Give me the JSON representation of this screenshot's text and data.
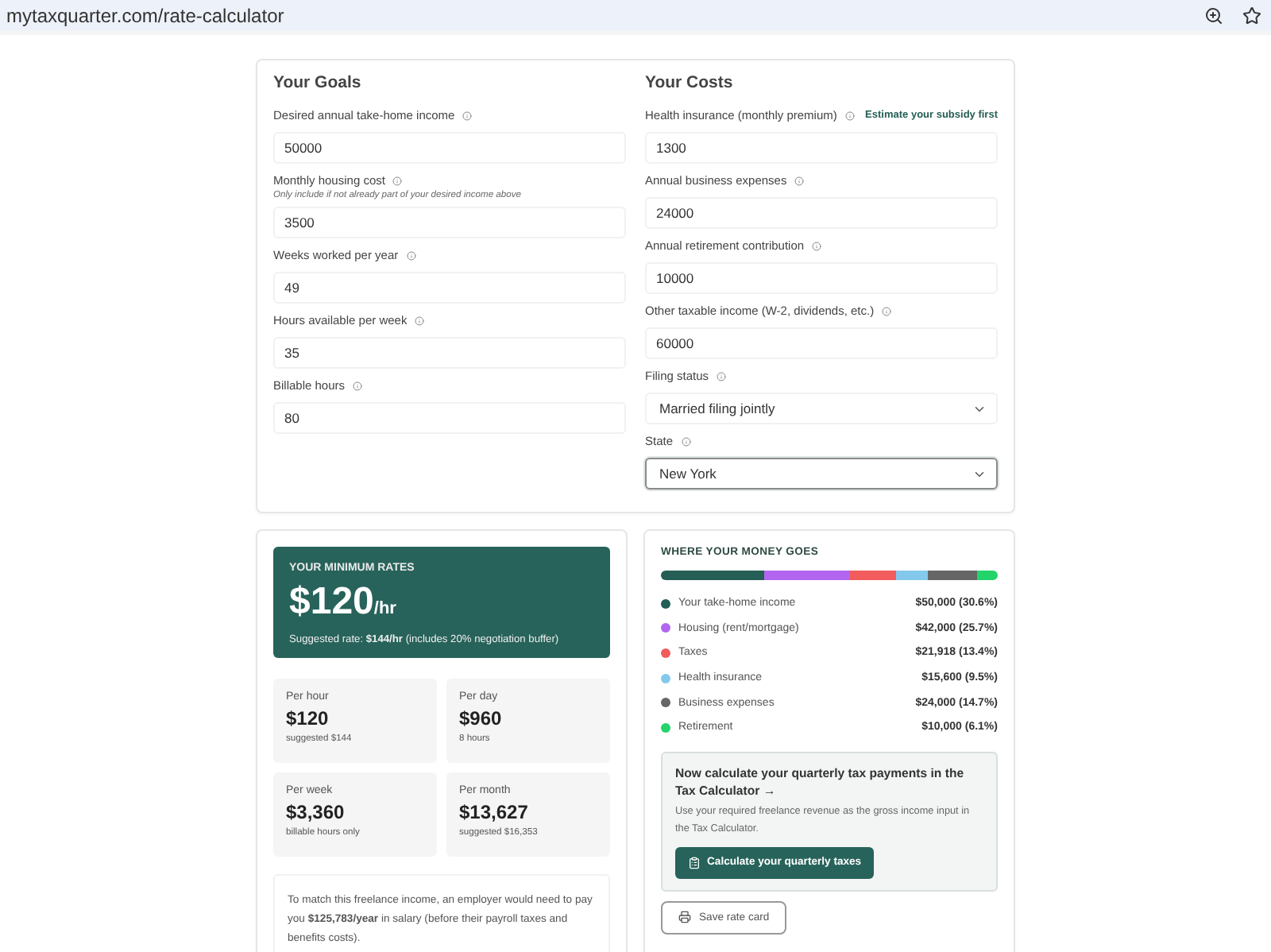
{
  "browser": {
    "url": "mytaxquarter.com/rate-calculator"
  },
  "goals": {
    "title": "Your Goals",
    "fields": [
      {
        "kind": "text",
        "label": "Desired annual take-home income",
        "value": "50000"
      },
      {
        "kind": "text",
        "label": "Monthly housing cost",
        "hint": "Only include if not already part of your desired income above",
        "value": "3500"
      },
      {
        "kind": "text",
        "label": "Weeks worked per year",
        "value": "49"
      },
      {
        "kind": "text",
        "label": "Hours available per week",
        "value": "35"
      },
      {
        "kind": "text",
        "label": "Billable hours",
        "value": "80"
      }
    ]
  },
  "costs": {
    "title": "Your Costs",
    "fields": [
      {
        "kind": "text",
        "label": "Health insurance (monthly premium)",
        "link": "Estimate your subsidy first",
        "value": "1300"
      },
      {
        "kind": "text",
        "label": "Annual business expenses",
        "value": "24000"
      },
      {
        "kind": "text",
        "label": "Annual retirement contribution",
        "value": "10000"
      },
      {
        "kind": "text",
        "label": "Other taxable income (W-2, dividends, etc.)",
        "value": "60000"
      },
      {
        "kind": "select",
        "label": "Filing status",
        "value": "Married filing jointly",
        "focused": false
      },
      {
        "kind": "select",
        "label": "State",
        "value": "New York",
        "focused": true
      }
    ]
  },
  "rates": {
    "title": "YOUR MINIMUM RATES",
    "amount": "$120",
    "unit": "/hr",
    "suggestion": "Suggested rate: **$144/hr** (includes 20% negotiation buffer)",
    "stats": [
      {
        "label": "Per hour",
        "value": "$120",
        "note": "suggested $144"
      },
      {
        "label": "Per day",
        "value": "$960",
        "note": "8 hours"
      },
      {
        "label": "Per week",
        "value": "$3,360",
        "note": "billable hours only"
      },
      {
        "label": "Per month",
        "value": "$13,627",
        "note": "suggested $16,353"
      }
    ],
    "employer_note": "To match this freelance income, an employer would need to pay you **$125,783/year** in salary (before their payroll taxes and benefits costs)."
  },
  "breakdown": {
    "title": "WHERE YOUR MONEY GOES",
    "items": [
      {
        "label": "Your take-home income",
        "amount": "$50,000 (30.6%)",
        "color": "#245e55"
      },
      {
        "label": "Housing (rent/mortgage)",
        "amount": "$42,000 (25.7%)",
        "color": "#b266f0"
      },
      {
        "label": "Taxes",
        "amount": "$21,918 (13.4%)",
        "color": "#f25c5c"
      },
      {
        "label": "Health insurance",
        "amount": "$15,600 (9.5%)",
        "color": "#84c9ec"
      },
      {
        "label": "Business expenses",
        "amount": "$24,000 (14.7%)",
        "color": "#666666"
      },
      {
        "label": "Retirement",
        "amount": "$10,000 (6.1%)",
        "color": "#22d46a"
      }
    ]
  },
  "cta": {
    "title": "Now calculate your quarterly tax payments in the Tax Calculator →",
    "text": "Use your required freelance revenue as the gross income input in the Tax Calculator.",
    "button": "Calculate your quarterly taxes"
  },
  "save_button": "Save rate card"
}
